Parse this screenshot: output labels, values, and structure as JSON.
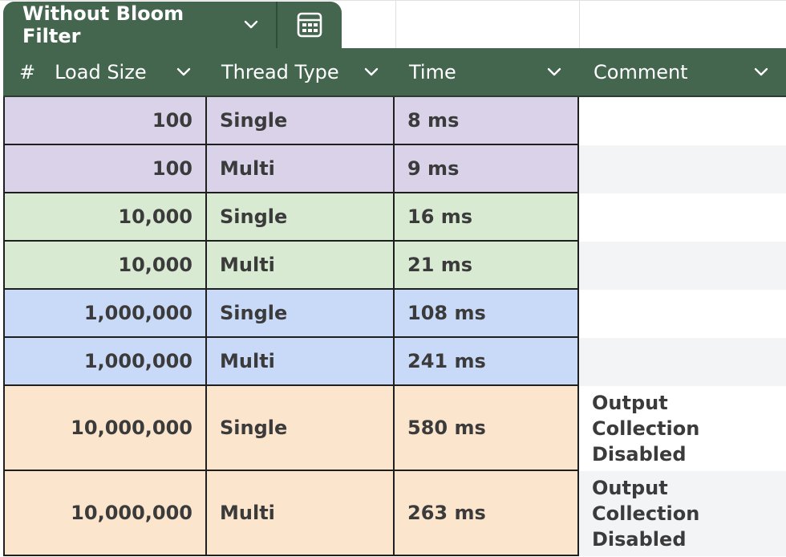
{
  "table_tab": {
    "name": "Without Bloom Filter",
    "dropdown_icon": "chevron-down-icon",
    "calculator_icon": "calculator-icon"
  },
  "header": {
    "row_number_symbol": "#",
    "columns": [
      {
        "label": "Load Size"
      },
      {
        "label": "Thread Type"
      },
      {
        "label": "Time"
      },
      {
        "label": "Comment"
      }
    ]
  },
  "colors": {
    "header_bg": "#44664f",
    "purple": "#d9d2e9",
    "green": "#d9ead3",
    "blue": "#c9daf8",
    "peach": "#fce5cd",
    "comment_white": "#ffffff",
    "comment_gray": "#f3f4f6"
  },
  "rows": [
    {
      "load_size": "100",
      "thread_type": "Single",
      "time": "8 ms",
      "comment": "",
      "color": "purple"
    },
    {
      "load_size": "100",
      "thread_type": "Multi",
      "time": "9 ms",
      "comment": "",
      "color": "purple"
    },
    {
      "load_size": "10,000",
      "thread_type": "Single",
      "time": "16 ms",
      "comment": "",
      "color": "green"
    },
    {
      "load_size": "10,000",
      "thread_type": "Multi",
      "time": "21 ms",
      "comment": "",
      "color": "green"
    },
    {
      "load_size": "1,000,000",
      "thread_type": "Single",
      "time": "108 ms",
      "comment": "",
      "color": "blue"
    },
    {
      "load_size": "1,000,000",
      "thread_type": "Multi",
      "time": "241 ms",
      "comment": "",
      "color": "blue"
    },
    {
      "load_size": "10,000,000",
      "thread_type": "Single",
      "time": "580 ms",
      "comment": "Output\nCollection\nDisabled",
      "color": "peach"
    },
    {
      "load_size": "10,000,000",
      "thread_type": "Multi",
      "time": "263 ms",
      "comment": "Output\nCollection\nDisabled",
      "color": "peach"
    }
  ]
}
